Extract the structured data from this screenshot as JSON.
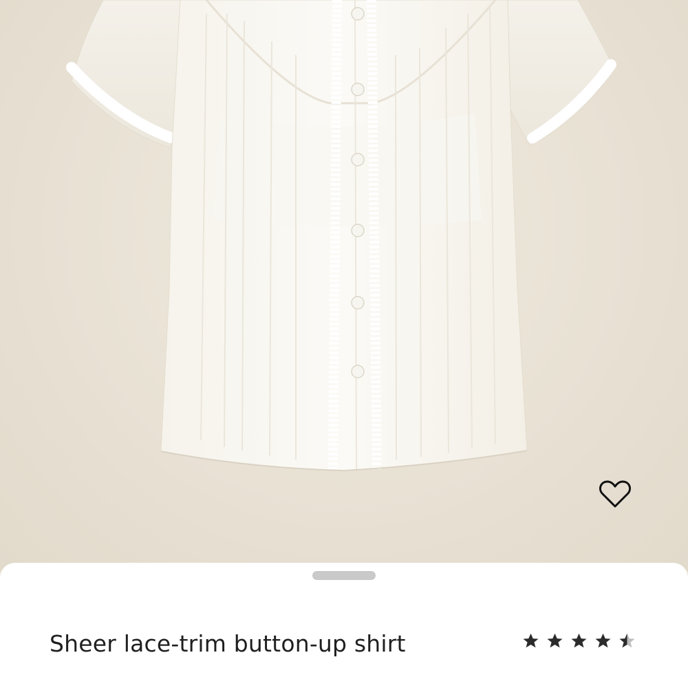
{
  "product": {
    "title": "Sheer lace-trim button-up shirt",
    "rating": 4.5,
    "rating_max": 5
  },
  "icons": {
    "favorite": "heart-outline-icon",
    "star": "star-icon",
    "half_star": "star-half-icon"
  },
  "colors": {
    "background": "#e9e2d5",
    "sheet": "#ffffff",
    "handle": "#c9c9c9",
    "title": "#1f1f1f",
    "star": "#2b2b2b",
    "star_empty": "#bdbdbd"
  }
}
